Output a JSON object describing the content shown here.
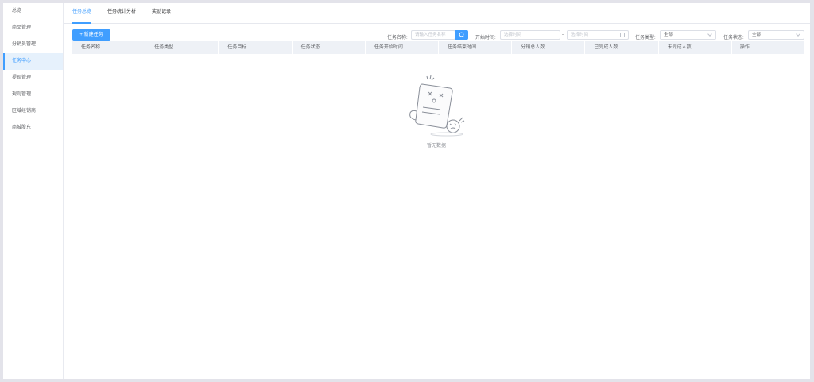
{
  "sidebar": {
    "items": [
      {
        "label": "总览",
        "active": false
      },
      {
        "label": "商品管理",
        "active": false
      },
      {
        "label": "分销员管理",
        "active": false
      },
      {
        "label": "任务中心",
        "active": true
      },
      {
        "label": "提现管理",
        "active": false
      },
      {
        "label": "规则管理",
        "active": false
      },
      {
        "label": "区域经销商",
        "active": false
      },
      {
        "label": "商城股东",
        "active": false
      }
    ]
  },
  "tabs": [
    {
      "label": "任务总览",
      "active": true
    },
    {
      "label": "任务统计分析",
      "active": false
    },
    {
      "label": "奖励记录",
      "active": false
    }
  ],
  "toolbar": {
    "new_task_label": "+ 新建任务",
    "task_name_label": "任务名称:",
    "task_name_placeholder": "请输入任务名称",
    "start_time_label": "开始时间:",
    "start_placeholder": "选择时间",
    "range_separator": "-",
    "end_placeholder": "选择时间",
    "task_type_label": "任务类型:",
    "task_type_value": "全部",
    "task_status_label": "任务状态:",
    "task_status_value": "全部"
  },
  "table": {
    "columns": [
      "任务名称",
      "任务类型",
      "任务目标",
      "任务状态",
      "任务开始时间",
      "任务结束时间",
      "分销总人数",
      "已完成人数",
      "未完成人数",
      "操作"
    ],
    "empty_text": "暂无数据"
  },
  "colors": {
    "accent": "#409eff",
    "header_bg": "#eef1f6",
    "active_bg": "#e6f1fc"
  }
}
